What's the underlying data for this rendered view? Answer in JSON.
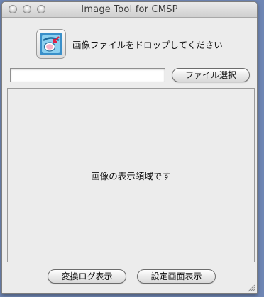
{
  "window": {
    "title": "Image Tool for CMSP"
  },
  "drop": {
    "label": "画像ファイルをドロップしてください"
  },
  "file": {
    "path_value": "",
    "select_label": "ファイル選択"
  },
  "display": {
    "placeholder": "画像の表示領域です"
  },
  "footer": {
    "log_label": "変換ログ表示",
    "settings_label": "設定画面表示"
  },
  "icons": {
    "window_buttons": [
      "close-icon",
      "minimize-icon",
      "zoom-icon"
    ],
    "app": "image-tool-app-icon",
    "resize": "resize-grip-icon"
  },
  "colors": {
    "desktop": "#6f86b4",
    "window_bg": "#ececec"
  }
}
